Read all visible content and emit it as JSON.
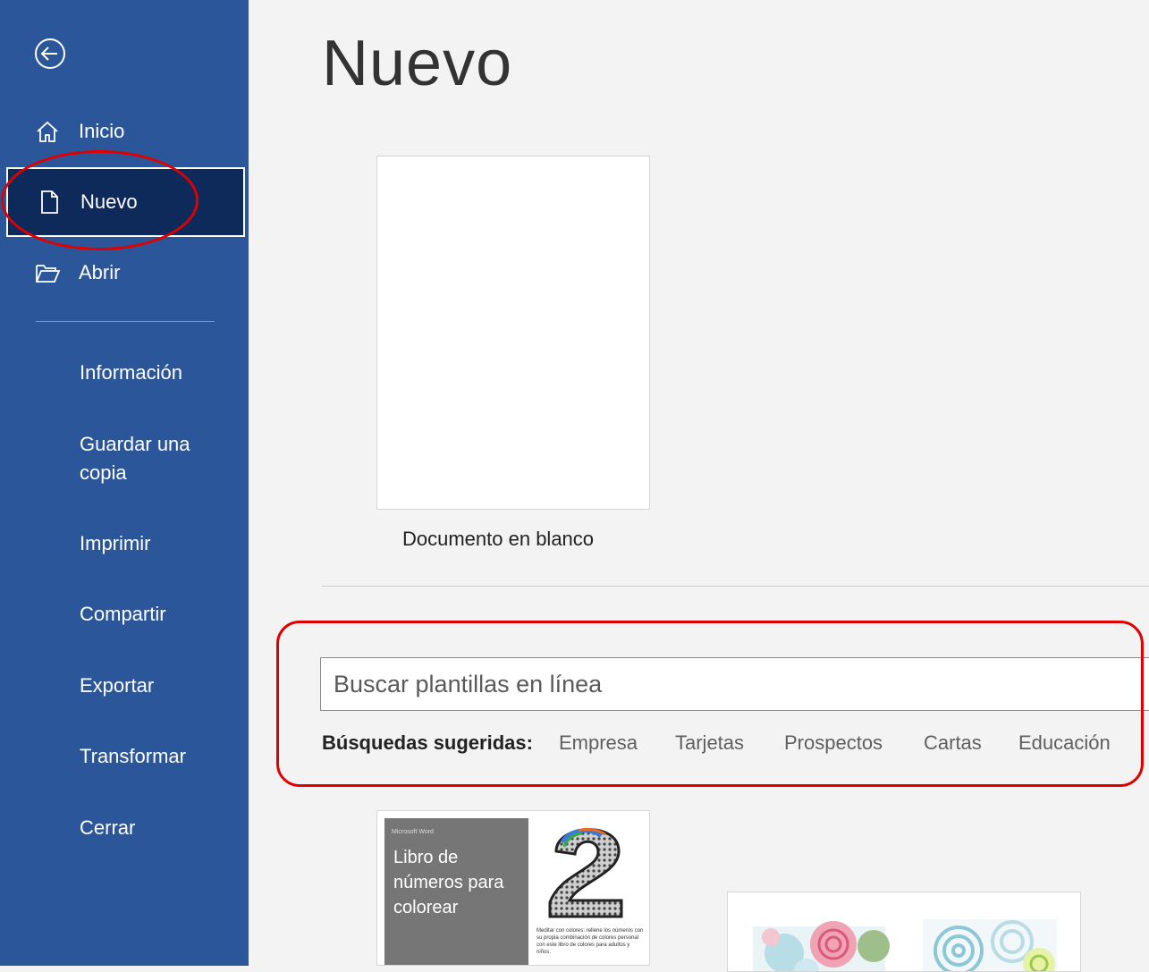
{
  "sidebar": {
    "items": [
      {
        "label": "Inicio"
      },
      {
        "label": "Nuevo"
      },
      {
        "label": "Abrir"
      }
    ],
    "secondary": [
      {
        "label": "Información"
      },
      {
        "label": "Guardar una copia"
      },
      {
        "label": "Imprimir"
      },
      {
        "label": "Compartir"
      },
      {
        "label": "Exportar"
      },
      {
        "label": "Transformar"
      },
      {
        "label": "Cerrar"
      }
    ]
  },
  "main": {
    "title": "Nuevo",
    "blank_label": "Documento en blanco",
    "search_placeholder": "Buscar plantillas en línea",
    "suggested_label": "Búsquedas sugeridas:",
    "suggestions": [
      "Empresa",
      "Tarjetas",
      "Prospectos",
      "Cartas",
      "Educación"
    ],
    "template1": {
      "brand": "Microsoft Word",
      "title": "Libro de números para colorear",
      "description": "Meditar con colores: rellene los números con su propia combinación de colores personal con este libro de colores para adultos y niños."
    }
  },
  "colors": {
    "sidebar": "#2b579a",
    "sidebar_active": "#0d2a5a",
    "annotation": "#e00000"
  }
}
